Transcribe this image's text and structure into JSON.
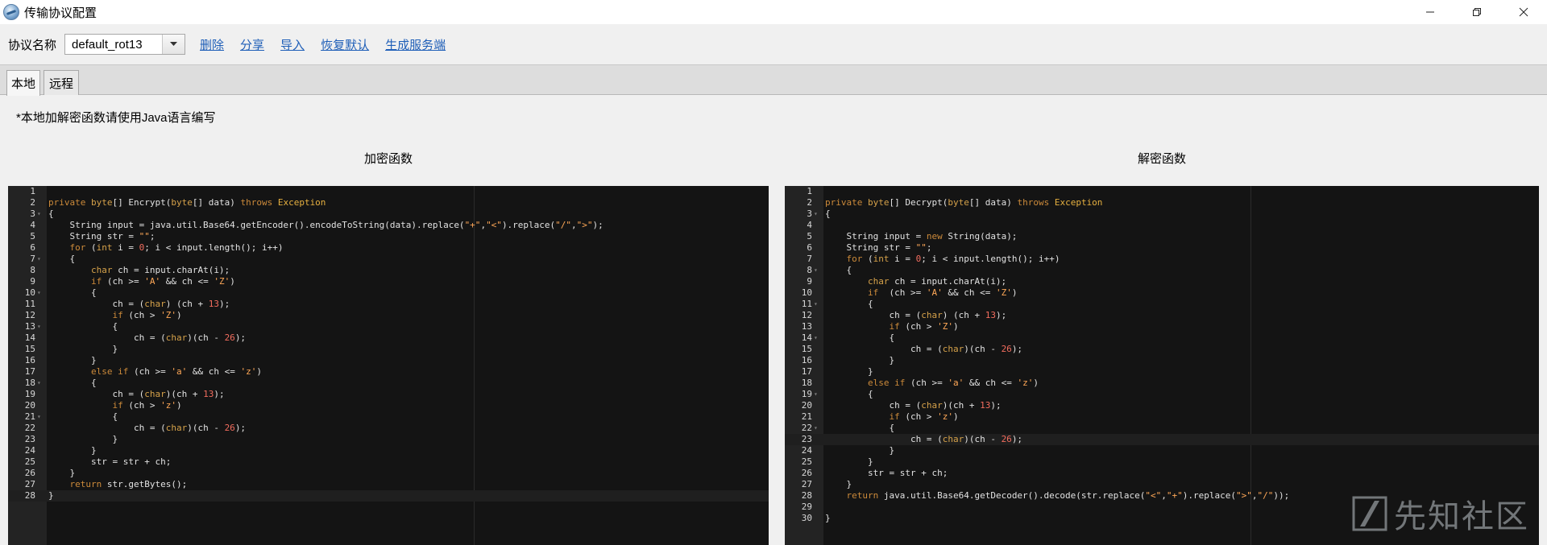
{
  "window": {
    "title": "传输协议配置"
  },
  "toolbar": {
    "protocol_label": "协议名称",
    "protocol_value": "default_rot13",
    "links": [
      "删除",
      "分享",
      "导入",
      "恢复默认",
      "生成服务端"
    ]
  },
  "tabs": [
    "本地",
    "远程"
  ],
  "active_tab": "本地",
  "note": "*本地加解密函数请使用Java语言编写",
  "encrypt": {
    "title": "加密函数",
    "current_line": 28,
    "fold_lines": [
      3,
      7,
      10,
      13,
      18,
      21
    ],
    "lines": [
      "",
      "private byte[] Encrypt(byte[] data) throws Exception",
      "{",
      "    String input = java.util.Base64.getEncoder().encodeToString(data).replace(\"+\",\"<\").replace(\"/\",\">\");",
      "    String str = \"\";",
      "    for (int i = 0; i < input.length(); i++)",
      "    {",
      "        char ch = input.charAt(i);",
      "        if (ch >= 'A' && ch <= 'Z')",
      "        {",
      "            ch = (char) (ch + 13);",
      "            if (ch > 'Z')",
      "            {",
      "                ch = (char)(ch - 26);",
      "            }",
      "        }",
      "        else if (ch >= 'a' && ch <= 'z')",
      "        {",
      "            ch = (char)(ch + 13);",
      "            if (ch > 'z')",
      "            {",
      "                ch = (char)(ch - 26);",
      "            }",
      "        }",
      "        str = str + ch;",
      "    }",
      "    return str.getBytes();",
      "}"
    ]
  },
  "decrypt": {
    "title": "解密函数",
    "current_line": 23,
    "fold_lines": [
      3,
      8,
      11,
      14,
      19,
      22
    ],
    "lines": [
      "",
      "private byte[] Decrypt(byte[] data) throws Exception",
      "{",
      "",
      "    String input = new String(data);",
      "    String str = \"\";",
      "    for (int i = 0; i < input.length(); i++)",
      "    {",
      "        char ch = input.charAt(i);",
      "        if  (ch >= 'A' && ch <= 'Z')",
      "        {",
      "            ch = (char) (ch + 13);",
      "            if (ch > 'Z')",
      "            {",
      "                ch = (char)(ch - 26);",
      "            }",
      "        }",
      "        else if (ch >= 'a' && ch <= 'z')",
      "        {",
      "            ch = (char)(ch + 13);",
      "            if (ch > 'z')",
      "            {",
      "                ch = (char)(ch - 26);",
      "            }",
      "        }",
      "        str = str + ch;",
      "    }",
      "    return java.util.Base64.getDecoder().decode(str.replace(\"<\",\"+\").replace(\">\",\"/\"));",
      "",
      "}"
    ]
  },
  "watermark": "先知社区",
  "colors": {
    "link": "#1f5fb8",
    "editor_bg": "#141414",
    "gutter_bg": "#232323",
    "keyword": "#cc8a3a",
    "string": "#ffa857",
    "number": "#f26d5e"
  }
}
